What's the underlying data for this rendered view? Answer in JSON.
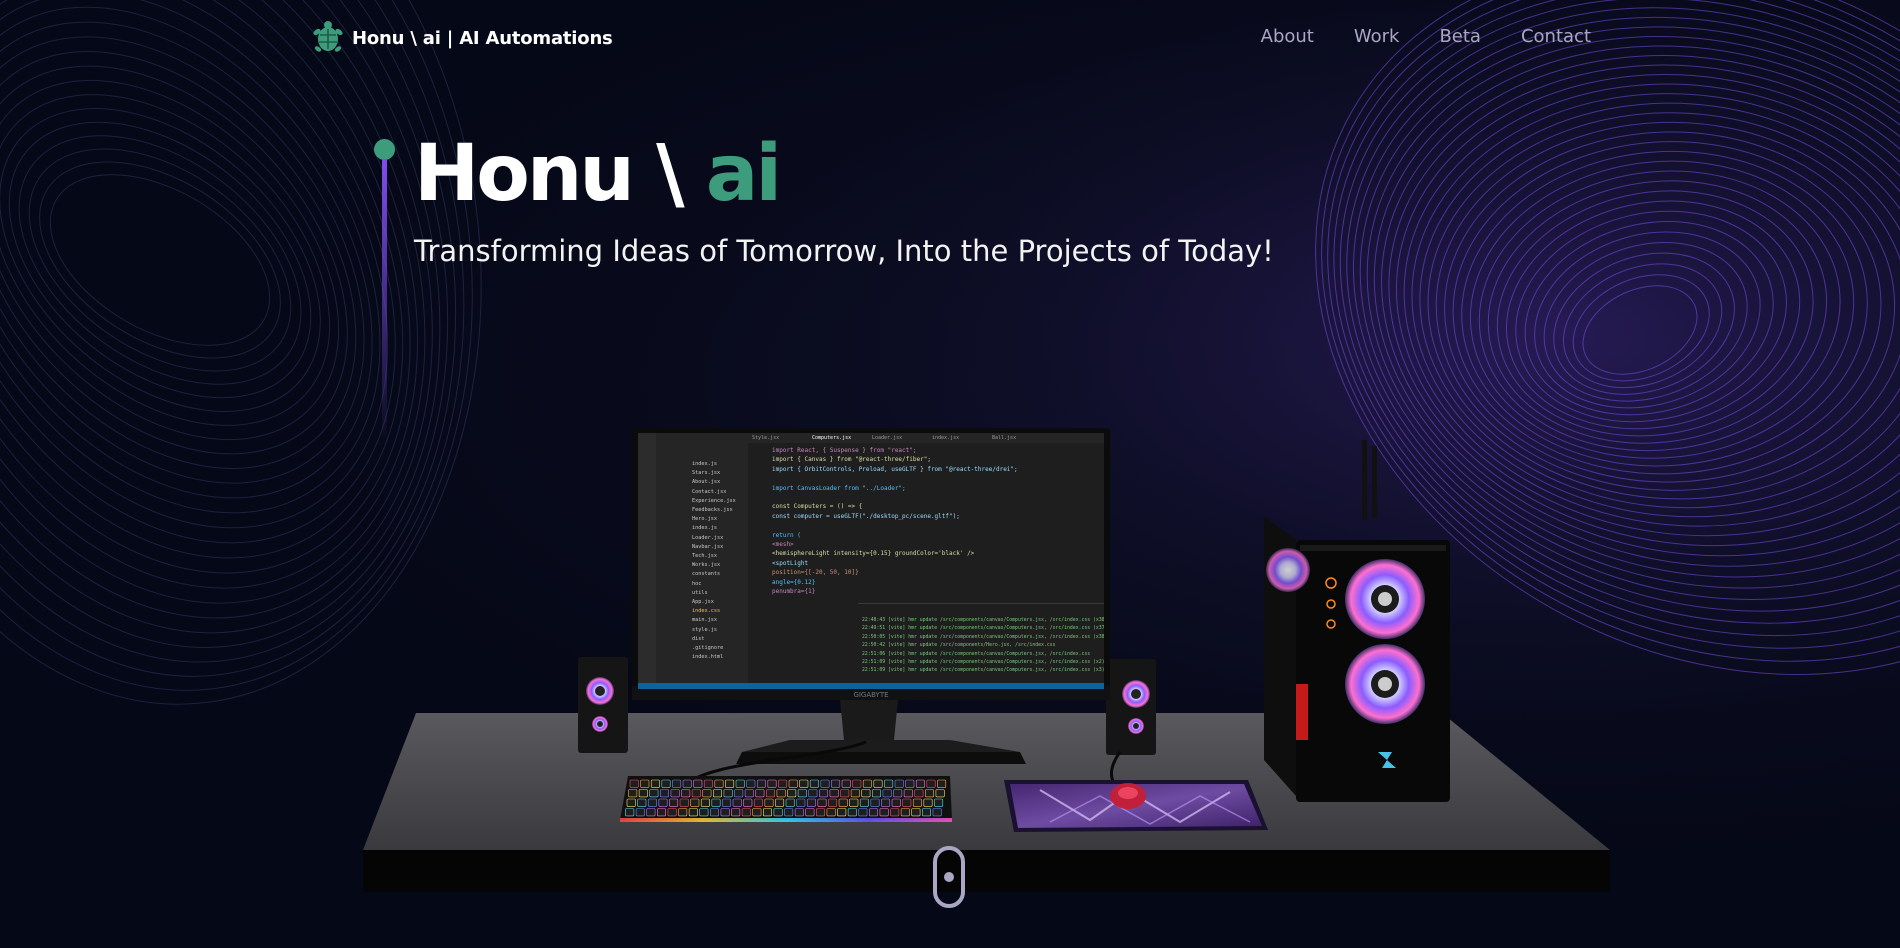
{
  "navbar": {
    "brand_name": "Honu \\ ai  | AI Automations",
    "logo_icon": "turtle-icon",
    "links": [
      {
        "label": "About"
      },
      {
        "label": "Work"
      },
      {
        "label": "Beta"
      },
      {
        "label": "Contact"
      }
    ]
  },
  "hero": {
    "title_main": "Honu \\ ",
    "title_accent": "ai",
    "subtitle": "Transforming Ideas of Tomorrow, Into the Projects of Today!"
  },
  "scene": {
    "monitor_brand": "GIGABYTE",
    "editor": {
      "tabs": [
        "Style.jsx",
        "Computers.jsx",
        "Loader.jsx",
        "index.jsx",
        "Ball.jsx"
      ],
      "explorer_files": [
        "index.js",
        "Stars.jsx",
        "About.jsx",
        "Contact.jsx",
        "Experience.jsx",
        "Feedbacks.jsx",
        "Hero.jsx",
        "index.js",
        "Loader.jsx",
        "Navbar.jsx",
        "Tech.jsx",
        "Works.jsx",
        "constants",
        "hoc",
        "utils",
        "App.jsx",
        "index.css",
        "main.jsx",
        "style.js",
        "dist",
        ".gitignore",
        "index.html"
      ],
      "code_lines": [
        "import React, { Suspense } from \"react\";",
        "import { Canvas } from \"@react-three/fiber\";",
        "import { OrbitControls, Preload, useGLTF } from \"@react-three/drei\";",
        "",
        "import CanvasLoader from \"../Loader\";",
        "",
        "const Computers = () => {",
        "  const computer = useGLTF(\"./desktop_pc/scene.gltf\");",
        "",
        "  return (",
        "    <mesh>",
        "      <hemisphereLight intensity={0.15} groundColor='black' />",
        "      <spotLight",
        "        position={[-20, 50, 10]}",
        "        angle={0.12}",
        "        penumbra={1}"
      ],
      "terminal_lines": [
        "22:48:43 [vite] hmr update /src/components/canvas/Computers.jsx, /src/index.css (x38)",
        "22:49:51 [vite] hmr update /src/components/canvas/Computers.jsx, /src/index.css (x37)",
        "22:50:05 [vite] hmr update /src/components/canvas/Computers.jsx, /src/index.css (x38)",
        "22:50:42 [vite] hmr update /src/components/Hero.jsx, /src/index.css",
        "22:51:06 [vite] hmr update /src/components/canvas/Computers.jsx, /src/index.css",
        "22:51:09 [vite] hmr update /src/components/canvas/Computers.jsx, /src/index.css (x2)",
        "22:51:09 [vite] hmr update /src/components/canvas/Computers.jsx, /src/index.css (x3)"
      ]
    }
  },
  "scroll_indicator": {
    "icon": "scroll-mouse-icon"
  },
  "colors": {
    "background": "#050816",
    "accent_green": "#3d9c7c",
    "accent_purple": "#804dee",
    "nav_text": "#aaa6c3",
    "swirl": "#7b4ee6"
  }
}
